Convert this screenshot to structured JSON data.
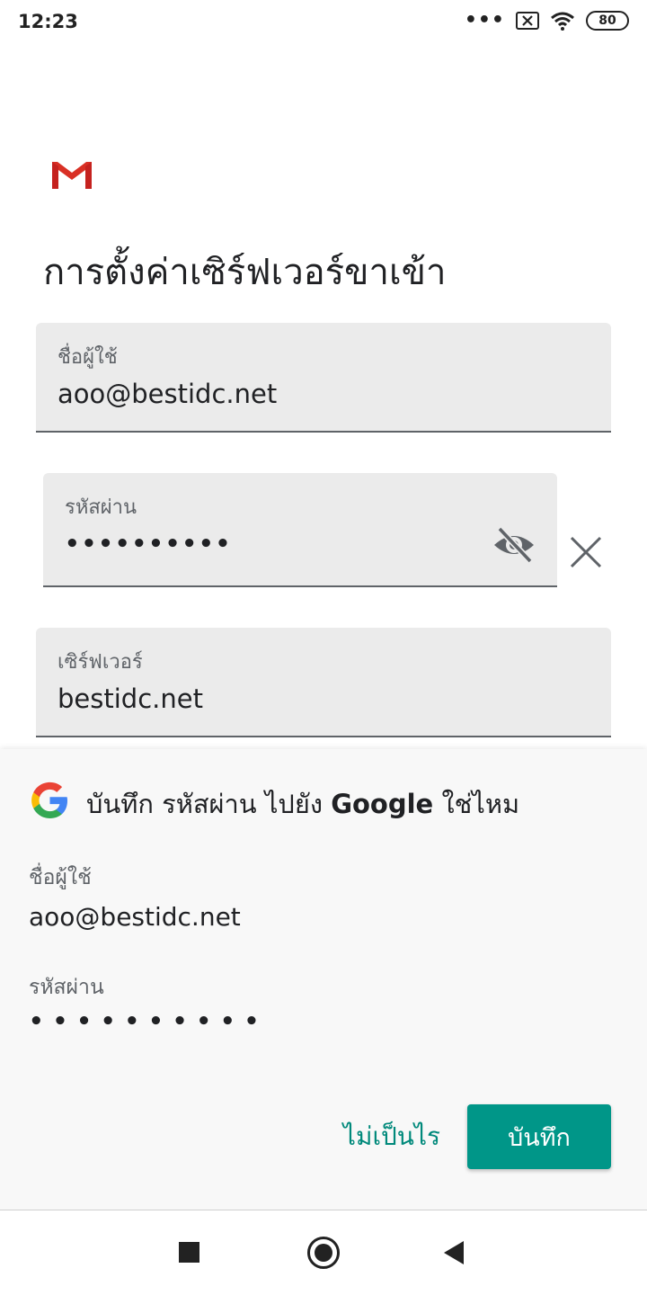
{
  "status_bar": {
    "time": "12:23",
    "overflow": "•••",
    "battery": "80",
    "icons": [
      "sim-off-icon",
      "wifi-icon",
      "battery-icon"
    ]
  },
  "app": {
    "logo": "gmail-logo",
    "title": "การตั้งค่าเซิร์ฟเวอร์ขาเข้า"
  },
  "form": {
    "username": {
      "label": "ชื่อผู้ใช้",
      "value": "aoo@bestidc.net"
    },
    "password": {
      "label": "รหัสผ่าน",
      "value": "••••••••••"
    },
    "server": {
      "label": "เซิร์ฟเวอร์",
      "value": "bestidc.net"
    }
  },
  "save_sheet": {
    "title_prefix": "บันทึก รหัสผ่าน ไปยัง ",
    "title_brand": "Google",
    "title_suffix": " ใช่ไหม",
    "username_label": "ชื่อผู้ใช้",
    "username_value": "aoo@bestidc.net",
    "password_label": "รหัสผ่าน",
    "password_value": "••••••••••",
    "no_thanks_label": "ไม่เป็นไร",
    "save_label": "บันทึก"
  },
  "colors": {
    "accent": "#009688",
    "field_bg": "#ebebeb",
    "sheet_bg": "#f8f8f8"
  }
}
